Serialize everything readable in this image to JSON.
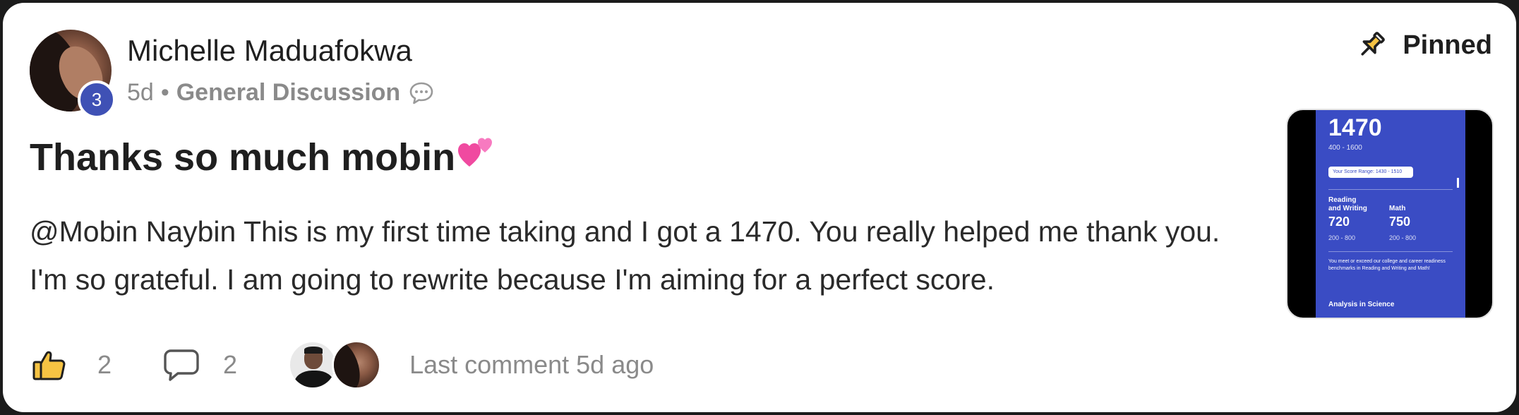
{
  "post": {
    "author": {
      "name": "Michelle Maduafokwa",
      "level": "3"
    },
    "time": "5d",
    "separator": "•",
    "category": "General Discussion",
    "pinned_label": "Pinned",
    "title": "Thanks so much mobin",
    "body": "@Mobin Naybin This is my first time taking and I got a 1470. You really helped me thank you. I'm so grateful. I am going to rewrite because I'm aiming for a perfect score.",
    "attachment": {
      "score": "1470",
      "range": "400 - 1600",
      "score_range_label": "Your Score Range: 1430 - 1510",
      "sections": [
        {
          "label": "Reading\nand Writing",
          "score": "720",
          "range": "200 - 800"
        },
        {
          "label": "Math",
          "score": "750",
          "range": "200 - 800"
        }
      ],
      "note": "You meet or exceed our college and career readiness benchmarks in Reading and Writing and Math!",
      "analysis_label": "Analysis in Science"
    },
    "footer": {
      "like_count": "2",
      "comment_count": "2",
      "last_comment": "Last comment 5d ago"
    }
  },
  "icons": {
    "pin": "pin-icon",
    "like": "thumbs-up-icon",
    "comment": "comment-bubble-icon",
    "category_comment": "chat-bubble-icon",
    "hearts": "two-hearts-emoji"
  },
  "colors": {
    "level_badge": "#3f51b5",
    "attachment_panel": "#3a4cc4",
    "muted_text": "#8a8a8a",
    "primary_text": "#1f1f1f"
  }
}
